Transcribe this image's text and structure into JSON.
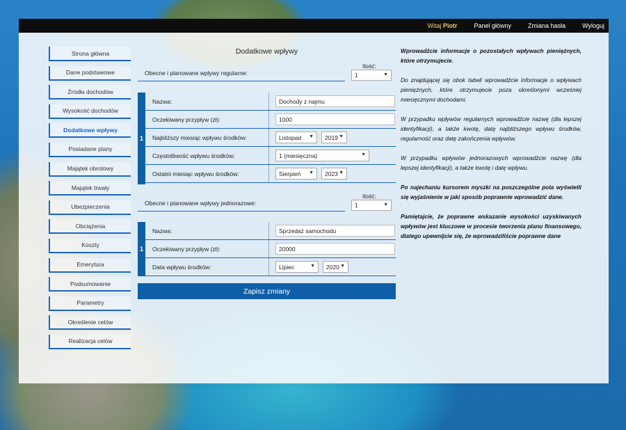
{
  "topbar": {
    "welcome_prefix": "Witaj",
    "user": "Piotr",
    "links": [
      "Panel główny",
      "Zmiana hasła",
      "Wyloguj"
    ]
  },
  "sidebar": {
    "items": [
      {
        "label": "Strona główna"
      },
      {
        "label": "Dane podstawowe"
      },
      {
        "label": "Źródła dochodów"
      },
      {
        "label": "Wysokość dochodów"
      },
      {
        "label": "Dodatkowe wpływy"
      },
      {
        "label": "Posiadane plany"
      },
      {
        "label": "Majątek obrotowy"
      },
      {
        "label": "Majątek trwały"
      },
      {
        "label": "Ubezpieczenia"
      },
      {
        "label": "Obciążenia"
      },
      {
        "label": "Koszty"
      },
      {
        "label": "Emerytura"
      },
      {
        "label": "Podsumowanie"
      },
      {
        "label": "Parametry"
      },
      {
        "label": "Określenie celów"
      },
      {
        "label": "Realizacja celów"
      }
    ],
    "active_index": 4
  },
  "form": {
    "title": "Dodatkowe wpływy",
    "regular": {
      "label": "Obecne i planowane wpływy regularne:",
      "count_label": "Ilość:",
      "count": "1",
      "group_number": "1",
      "name_label": "Nazwa:",
      "name_value": "Dochody z najmu",
      "amount_label": "Oczekiwany przypływ (zł):",
      "amount_value": "1000",
      "next_label": "Najbliższy miesiąc wpływu środków:",
      "next_month": "Listopad",
      "next_year": "2019",
      "freq_label": "Częstotliwość wpływu środków:",
      "freq_value": "1 (miesięczna)",
      "last_label": "Ostatni miesiąc wpływu środków:",
      "last_month": "Sierpień",
      "last_year": "2023"
    },
    "oneoff": {
      "label": "Obecne i planowane wpływy jednorazowe:",
      "count_label": "Ilość:",
      "count": "1",
      "group_number": "1",
      "name_label": "Nazwa:",
      "name_value": "Sprzedaż samochodu",
      "amount_label": "Oczekiwany przypływ (zł):",
      "amount_value": "20000",
      "date_label": "Data wpływu środków:",
      "date_month": "Lipiec",
      "date_year": "2020"
    },
    "save_label": "Zapisz zmiany"
  },
  "info": {
    "p1": "Wprowadźcie informacje o pozostałych wpływach pieniężnych, które otrzymujecie.",
    "p2": "Do znajdującej się obok tabeli wprowadźcie informacje o wpływach pieniężnych, które otrzymujecie poza określonymi wcześniej miesięcznymi dochodami.",
    "p3": "W przypadku wpływów regularnych wprowadźcie nazwę (dla lepszej identyfikacji), a także kwotę, datę najbliższego wpływu środków, regularność oraz datę zakończenia wpływów.",
    "p4": "W przypadku wpływów jednorazowych wprowadźcie nazwę (dla lepszej identyfikacji), a także kwotę i datę wpływu.",
    "p5": "Po najechaniu kursorem myszki na poszczególne pola wyświetli się wyjaśnienie w jaki sposób poprawnie wprowadzić dane.",
    "p6": "Pamiętajcie, że poprawne wskazanie wysokości uzyskiwanych wpływów jest kluczowe w procesie tworzenia planu finansowego, dlatego upewnijcie się, że wprowadziliście poprawne dane"
  },
  "icons": {
    "select_arrow": "chevron-down-icon"
  }
}
